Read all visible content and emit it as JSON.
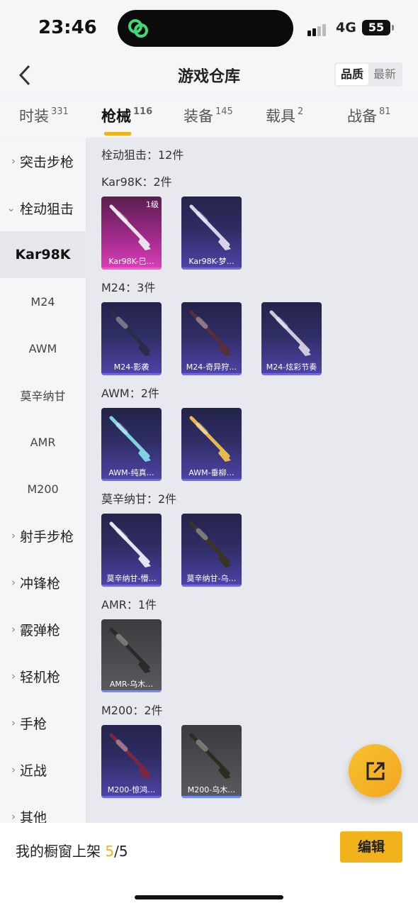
{
  "status": {
    "time": "23:46",
    "network": "4G",
    "battery": "55"
  },
  "header": {
    "title": "游戏仓库",
    "sort_options": [
      "品质",
      "最新"
    ],
    "sort_selected": "品质"
  },
  "tabs": [
    {
      "label": "时装",
      "count": "331"
    },
    {
      "label": "枪械",
      "count": "116"
    },
    {
      "label": "装备",
      "count": "145"
    },
    {
      "label": "载具",
      "count": "2"
    },
    {
      "label": "战备",
      "count": "81"
    }
  ],
  "sidebar": [
    {
      "label": "突击步枪",
      "type": "group"
    },
    {
      "label": "栓动狙击",
      "type": "group-open"
    },
    {
      "label": "Kar98K",
      "type": "selected"
    },
    {
      "label": "M24",
      "type": "sub"
    },
    {
      "label": "AWM",
      "type": "sub"
    },
    {
      "label": "莫辛纳甘",
      "type": "sub"
    },
    {
      "label": "AMR",
      "type": "sub"
    },
    {
      "label": "M200",
      "type": "sub"
    },
    {
      "label": "射手步枪",
      "type": "group"
    },
    {
      "label": "冲锋枪",
      "type": "group"
    },
    {
      "label": "霰弹枪",
      "type": "group"
    },
    {
      "label": "轻机枪",
      "type": "group"
    },
    {
      "label": "手枪",
      "type": "group"
    },
    {
      "label": "近战",
      "type": "group"
    },
    {
      "label": "其他",
      "type": "group"
    }
  ],
  "content": {
    "total": "栓动狙击：12件",
    "sections": [
      {
        "label": "Kar98K：2件",
        "items": [
          {
            "name": "Kar98K-巳…",
            "rarity": "pink",
            "level": "1级",
            "gun": "#e8e3ea"
          },
          {
            "name": "Kar98K-梦…",
            "rarity": "purple",
            "gun": "#d9d2e8"
          }
        ]
      },
      {
        "label": "M24：3件",
        "items": [
          {
            "name": "M24-影袭",
            "rarity": "purple",
            "gun": "#2a2d48"
          },
          {
            "name": "M24-奇异狩…",
            "rarity": "purple",
            "gun": "#5a2d3a"
          },
          {
            "name": "M24-炫彩节奏",
            "rarity": "purple",
            "gun": "#cfc8dc"
          }
        ]
      },
      {
        "label": "AWM：2件",
        "items": [
          {
            "name": "AWM-纯真…",
            "rarity": "purple",
            "gun": "#7fd3df"
          },
          {
            "name": "AWM-垂柳…",
            "rarity": "purple",
            "gun": "#e9b84a"
          }
        ]
      },
      {
        "label": "莫辛纳甘：2件",
        "items": [
          {
            "name": "莫辛纳甘-懵…",
            "rarity": "purple",
            "gun": "#dfe6f0"
          },
          {
            "name": "莫辛纳甘-乌…",
            "rarity": "purple",
            "gun": "#3b3422"
          }
        ]
      },
      {
        "label": "AMR：1件",
        "items": [
          {
            "name": "AMR-乌木…",
            "rarity": "gray",
            "gun": "#2b2b26"
          }
        ]
      },
      {
        "label": "M200：2件",
        "items": [
          {
            "name": "M200-惊鸿…",
            "rarity": "purple",
            "gun": "#7a2742"
          },
          {
            "name": "M200-乌木…",
            "rarity": "gray",
            "gun": "#2e2b20"
          }
        ]
      }
    ]
  },
  "footer": {
    "showcase_label": "我的橱窗上架",
    "current": "5",
    "max": "/5",
    "edit_label": "编辑"
  },
  "colors": {
    "accent": "#f2b21c",
    "purple_card": "#3a3478",
    "pink_card": "#c0359f"
  }
}
